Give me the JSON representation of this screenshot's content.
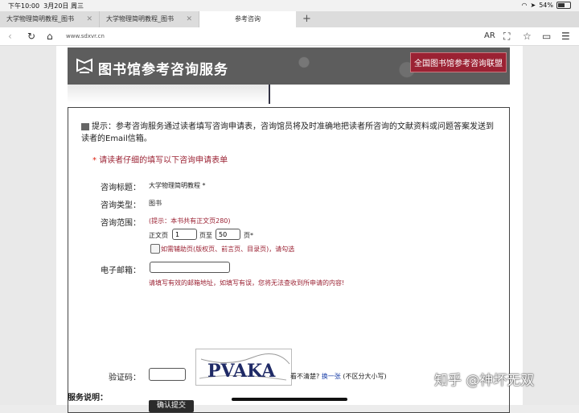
{
  "status": {
    "time": "下午10:00",
    "date": "3月20日 周三",
    "battery": "54%",
    "battery_level": 0.54
  },
  "tabs": [
    {
      "label": "大学物理简明教程_图书"
    },
    {
      "label": "大学物理简明教程_图书"
    },
    {
      "label": "参考咨询"
    }
  ],
  "newtab_icon": "plus-icon",
  "toolbar": {
    "url": "www.sdxvr.cn",
    "ar_label": "AR"
  },
  "banner": {
    "title": "图书馆参考咨询服务",
    "union_link": "全国图书馆参考咨询联盟",
    "bg_color": "#5d5d5d",
    "accent": "#9b2233"
  },
  "form": {
    "tip_prefix": "提示：",
    "tip_text": "参考咨询服务通过读者填写咨询申请表，咨询馆员将及时准确地把读者所咨询的文献资料或问题答案发送到读者的Email信箱。",
    "required_star": "*",
    "required_note": "请读者仔细的填写以下咨询申请表单",
    "title_label": "咨询标题：",
    "title_value": "大学物理简明教程",
    "title_star": "*",
    "type_label": "咨询类型：",
    "type_value": "图书",
    "range_label": "咨询范围：",
    "range_hint": "(提示：本书共有正文页280)",
    "page_from_label": "正文页",
    "page_from_value": "1",
    "page_to_label": "页至",
    "page_to_value": "50",
    "page_end_label": "页*",
    "aux_label": "如需辅助页(版权页、前言页、目录页)，请勾选",
    "email_label": "电子邮箱：",
    "email_value": "",
    "email_note": "请填写有效的邮箱地址，如填写有误，您将无法查收到所申请的内容!",
    "captcha_label": "验证码：",
    "captcha_value": "",
    "captcha_text": "PVAKA",
    "unclear_label": "看不清楚?",
    "refresh_link": "换一张",
    "case_note": "(不区分大小写)",
    "submit_label": "确认提交",
    "service_title": "服务说明："
  },
  "watermark": "知乎 @神坏无双"
}
